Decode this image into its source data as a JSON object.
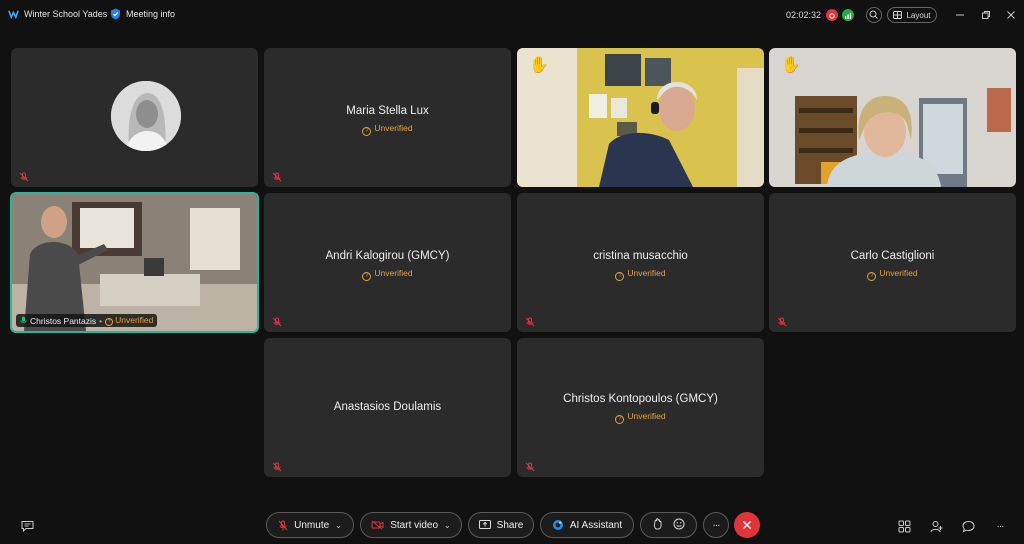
{
  "topbar": {
    "app_title": "Winter School Yades",
    "meeting_info": "Meeting info",
    "timer": "02:02:32",
    "layout_label": "Layout"
  },
  "colors": {
    "accent": "#22b8a0",
    "unverified": "#e6a23c",
    "end_call": "#e0343b",
    "mic_off": "#e0343b"
  },
  "unverified_label": "Unverified",
  "participants": [
    {
      "name": "",
      "type": "avatar",
      "muted": true
    },
    {
      "name": "Maria Stella Lux",
      "unverified": true,
      "muted": true
    },
    {
      "name": "",
      "type": "video",
      "hand_raised": true
    },
    {
      "name": "",
      "type": "video",
      "hand_raised": true
    },
    {
      "name": "Christos Pantazis",
      "type": "video",
      "active_speaker": true,
      "unverified": true
    },
    {
      "name": "Andri Kalogirou (GMCY)",
      "unverified": true,
      "muted": true
    },
    {
      "name": "cristina musacchio",
      "unverified": true,
      "muted": true
    },
    {
      "name": "Carlo Castiglioni",
      "unverified": true,
      "muted": true
    },
    {
      "name": "Anastasios Doulamis",
      "unverified": false,
      "muted": true
    },
    {
      "name": "Christos Kontopoulos (GMCY)",
      "unverified": true,
      "muted": true
    }
  ],
  "controls": {
    "unmute": "Unmute",
    "start_video": "Start video",
    "share": "Share",
    "ai_assistant": "AI Assistant",
    "more": "···"
  }
}
